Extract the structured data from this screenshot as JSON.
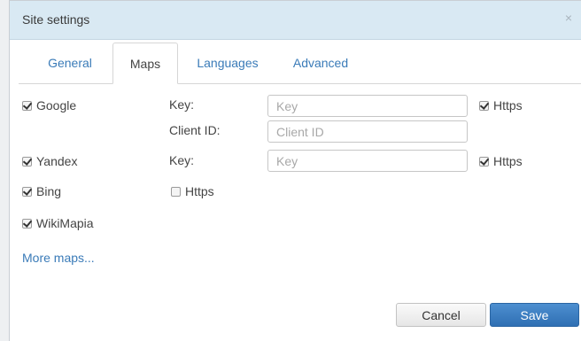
{
  "dialog": {
    "title": "Site settings",
    "close_icon": "×"
  },
  "tabs": [
    {
      "label": "General",
      "active": false
    },
    {
      "label": "Maps",
      "active": true
    },
    {
      "label": "Languages",
      "active": false
    },
    {
      "label": "Advanced",
      "active": false
    }
  ],
  "maps": {
    "google": {
      "label": "Google",
      "checked": true,
      "key_label": "Key:",
      "key_placeholder": "Key",
      "key_value": "",
      "client_id_label": "Client ID:",
      "client_id_placeholder": "Client ID",
      "client_id_value": "",
      "https_label": "Https",
      "https_checked": true
    },
    "yandex": {
      "label": "Yandex",
      "checked": true,
      "key_label": "Key:",
      "key_placeholder": "Key",
      "key_value": "",
      "https_label": "Https",
      "https_checked": true
    },
    "bing": {
      "label": "Bing",
      "checked": true,
      "https_label": "Https",
      "https_checked": false
    },
    "wikimapia": {
      "label": "WikiMapia",
      "checked": true
    },
    "more_maps": "More maps..."
  },
  "footer": {
    "cancel_label": "Cancel",
    "save_label": "Save"
  },
  "colors": {
    "titlebar": "#d9e9f3",
    "link": "#3a7bb8",
    "primary_button": "#3a7bc0"
  }
}
